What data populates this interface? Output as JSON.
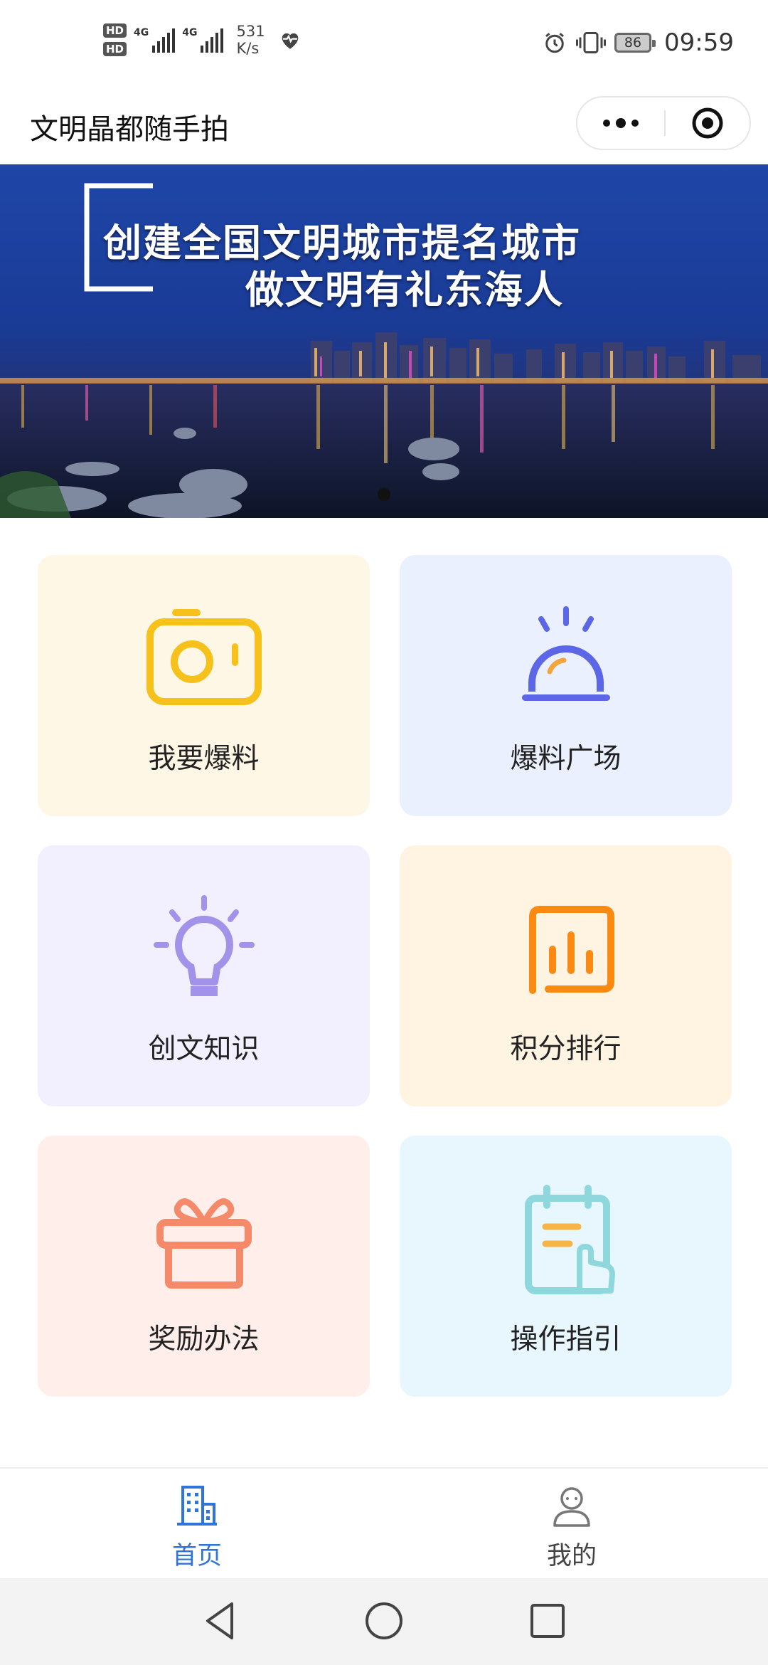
{
  "status_bar": {
    "hd1": "HD",
    "hd2": "HD",
    "net1": "4G",
    "net2": "4G",
    "speed_value": "531",
    "speed_unit": "K/s",
    "battery": "86",
    "time": "09:59"
  },
  "nav": {
    "title": "文明晶都随手拍"
  },
  "banner": {
    "line1": "创建全国文明城市提名城市",
    "line2": "做文明有礼东海人",
    "active_slide": 1,
    "slide_count": 1
  },
  "cards": [
    {
      "label": "我要爆料",
      "bg": "#FFF7E6",
      "icon": "camera-icon",
      "icon_color": "#F7C11B"
    },
    {
      "label": "爆料广场",
      "bg": "#EAF0FE",
      "icon": "alarm-light-icon",
      "icon_color": "#5B67E6"
    },
    {
      "label": "创文知识",
      "bg": "#F2EFFE",
      "icon": "lightbulb-icon",
      "icon_color": "#A392E9"
    },
    {
      "label": "积分排行",
      "bg": "#FFF3E1",
      "icon": "bar-chart-icon",
      "icon_color": "#FB8A12"
    },
    {
      "label": "奖励办法",
      "bg": "#FFEEEA",
      "icon": "gift-icon",
      "icon_color": "#F48A6A"
    },
    {
      "label": "操作指引",
      "bg": "#E8F6FE",
      "icon": "clipboard-touch-icon",
      "icon_color": "#8ED8DD"
    }
  ],
  "tabbar": {
    "home_label": "首页",
    "mine_label": "我的",
    "active_color": "#2F74D9",
    "inactive_color": "#555555"
  }
}
